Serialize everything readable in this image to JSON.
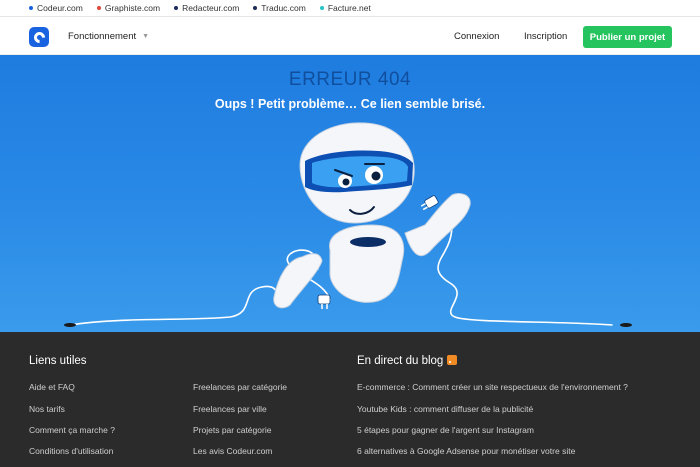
{
  "network": [
    {
      "label": "Codeur.com",
      "color": "#1a63e0"
    },
    {
      "label": "Graphiste.com",
      "color": "#e2463b"
    },
    {
      "label": "Redacteur.com",
      "color": "#1e2b5a"
    },
    {
      "label": "Traduc.com",
      "color": "#1e2b5a"
    },
    {
      "label": "Facture.net",
      "color": "#29c4c4"
    }
  ],
  "header": {
    "menu_label": "Fonctionnement",
    "login": "Connexion",
    "signup": "Inscription",
    "publish": "Publier un projet"
  },
  "hero": {
    "title": "ERREUR 404",
    "subtitle": "Oups ! Petit problème… Ce lien semble brisé."
  },
  "footer": {
    "useful_title": "Liens utiles",
    "useful_col1": [
      "Aide et FAQ",
      "Nos tarifs",
      "Comment ça marche ?",
      "Conditions d'utilisation"
    ],
    "useful_col2": [
      "Freelances par catégorie",
      "Freelances par ville",
      "Projets par catégorie",
      "Les avis Codeur.com"
    ],
    "blog_title": "En direct du blog",
    "blog_items": [
      "E-commerce : Comment créer un site respectueux de l'environnement ?",
      "Youtube Kids : comment diffuser de la publicité",
      "5 étapes pour gagner de l'argent sur Instagram",
      "6 alternatives à Google Adsense pour monétiser votre site"
    ]
  },
  "colors": {
    "brand": "#1a63e0",
    "cta": "#25c45f",
    "hero": "#2a8ae6",
    "footer": "#2b2b2b"
  }
}
